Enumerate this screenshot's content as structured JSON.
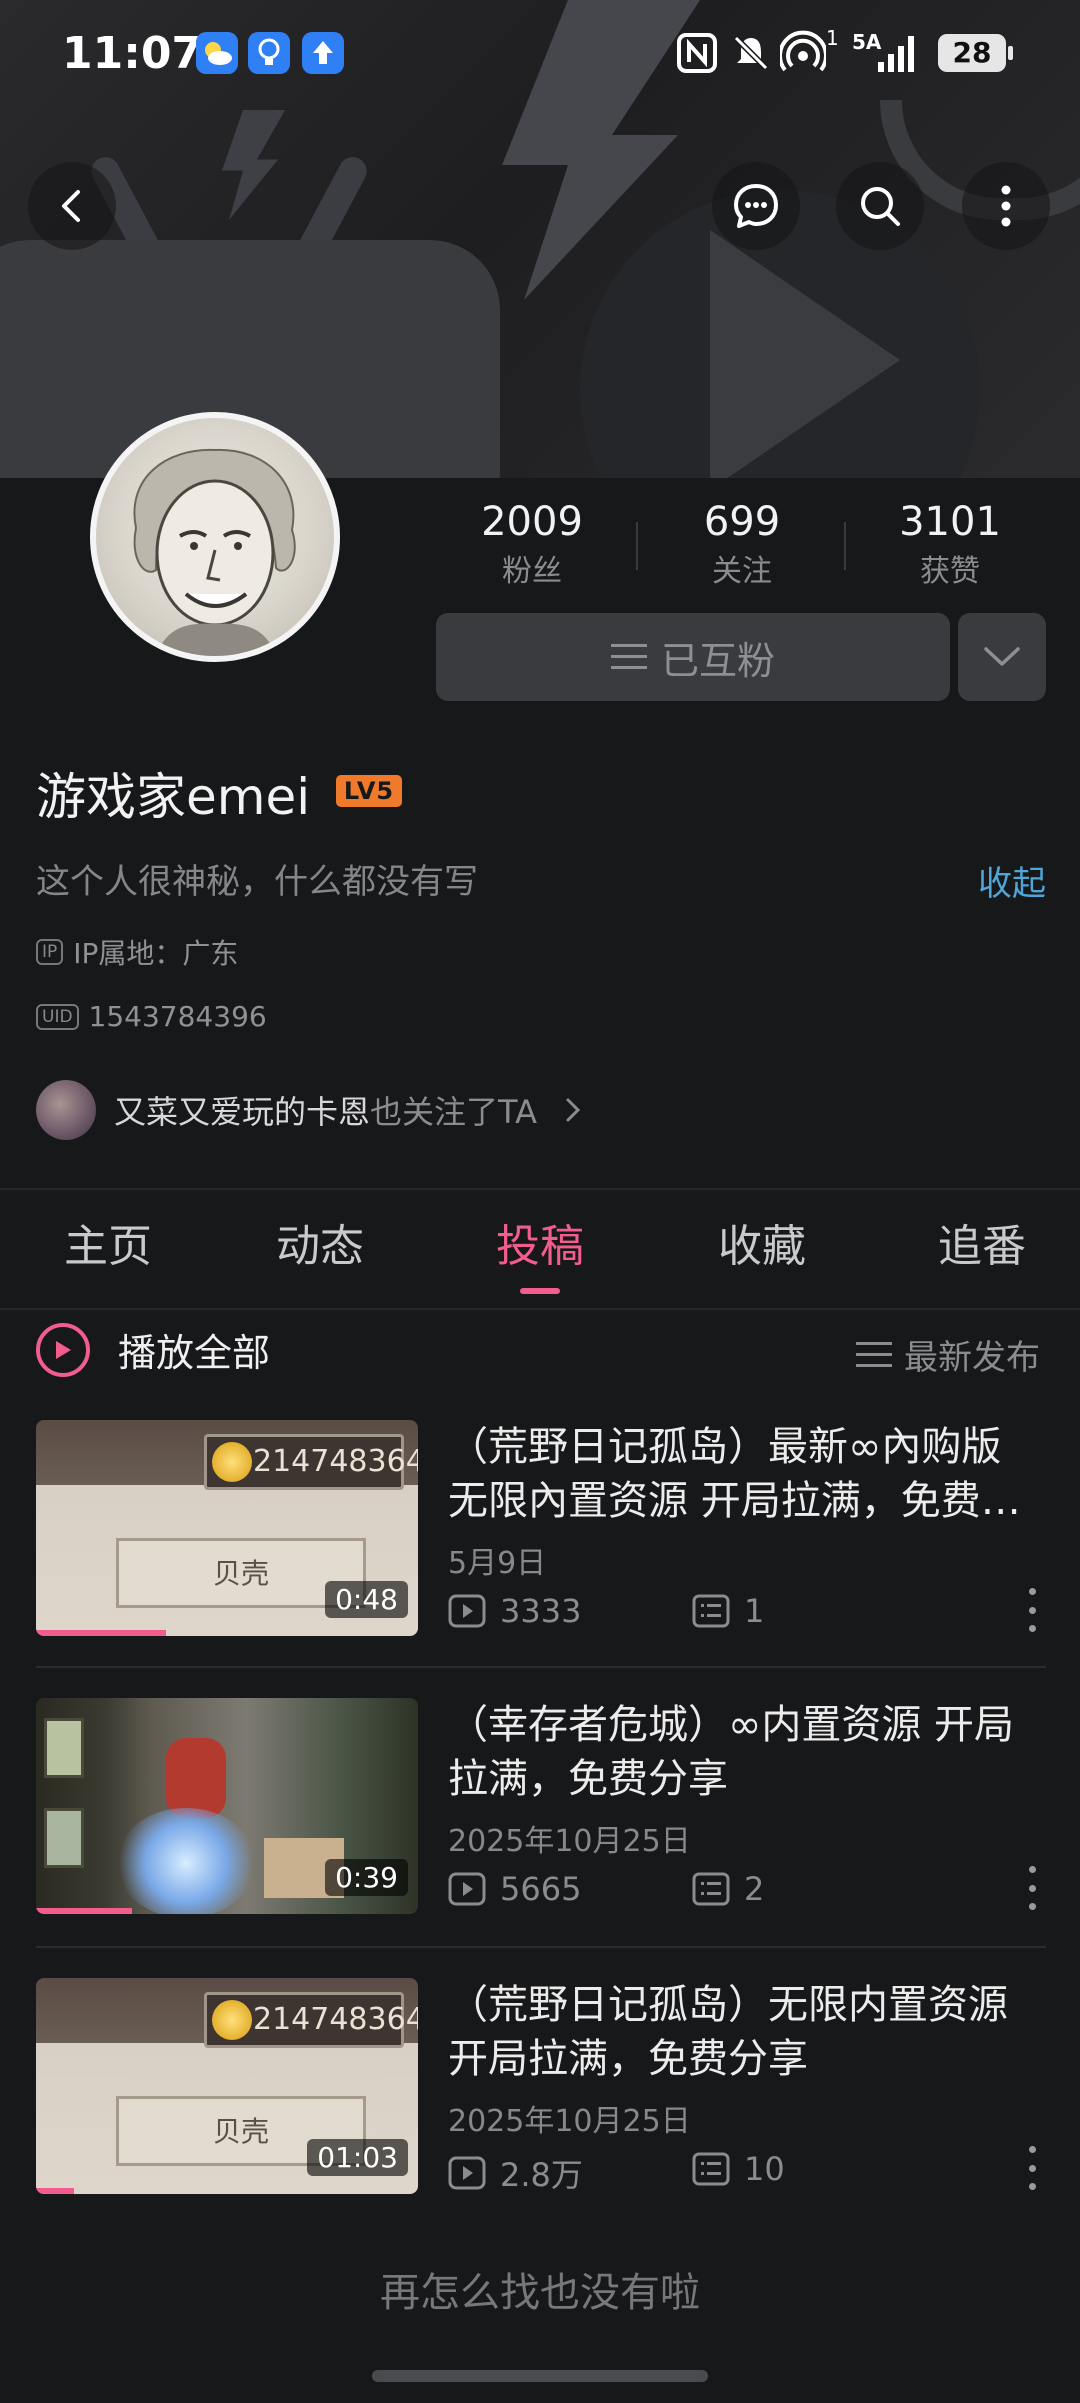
{
  "status_bar": {
    "time": "11:07",
    "signal_label": "5A",
    "sim_index": "1",
    "battery": "28"
  },
  "profile": {
    "stats": [
      {
        "value": "2009",
        "label": "粉丝"
      },
      {
        "value": "699",
        "label": "关注"
      },
      {
        "value": "3101",
        "label": "获赞"
      }
    ],
    "mutual_label": "已互粉",
    "username": "游戏家emei",
    "level": "LV5",
    "bio": "这个人很神秘，什么都没有写",
    "collapse_label": "收起",
    "ip_badge": "IP",
    "ip_location": "IP属地：广东",
    "uid_badge": "UID",
    "uid": "1543784396",
    "follower_name": "又菜又爱玩的卡恩",
    "follower_suffix": "也关注了TA"
  },
  "tabs": [
    {
      "label": "主页"
    },
    {
      "label": "动态"
    },
    {
      "label": "投稿",
      "active": true
    },
    {
      "label": "收藏"
    },
    {
      "label": "追番"
    }
  ],
  "list_header": {
    "play_all": "播放全部",
    "sort": "最新发布"
  },
  "videos": [
    {
      "title": "（荒野日记孤岛）最新∞內购版 无限內置资源 开局拉满，免费分享",
      "date": "5月9日",
      "views": "3333",
      "comments": "1",
      "duration": "0:48",
      "progress": 0.34,
      "thumb_coin": "214748364",
      "thumb_plate": "贝壳"
    },
    {
      "title": "（幸存者危城）∞内置资源 开局拉满，免费分享",
      "date": "2025年10月25日",
      "views": "5665",
      "comments": "2",
      "duration": "0:39",
      "progress": 0.25
    },
    {
      "title": "（荒野日记孤岛）无限内置资源 开局拉满，免费分享",
      "date": "2025年10月25日",
      "views": "2.8万",
      "comments": "10",
      "duration": "01:03",
      "progress": 0.1,
      "thumb_coin": "214748364",
      "thumb_plate": "贝壳"
    }
  ],
  "end_text": "再怎么找也没有啦",
  "colors": {
    "accent": "#f25d8e",
    "link": "#4fa6d8",
    "level_badge": "#f07a2c",
    "background": "#17181a"
  }
}
